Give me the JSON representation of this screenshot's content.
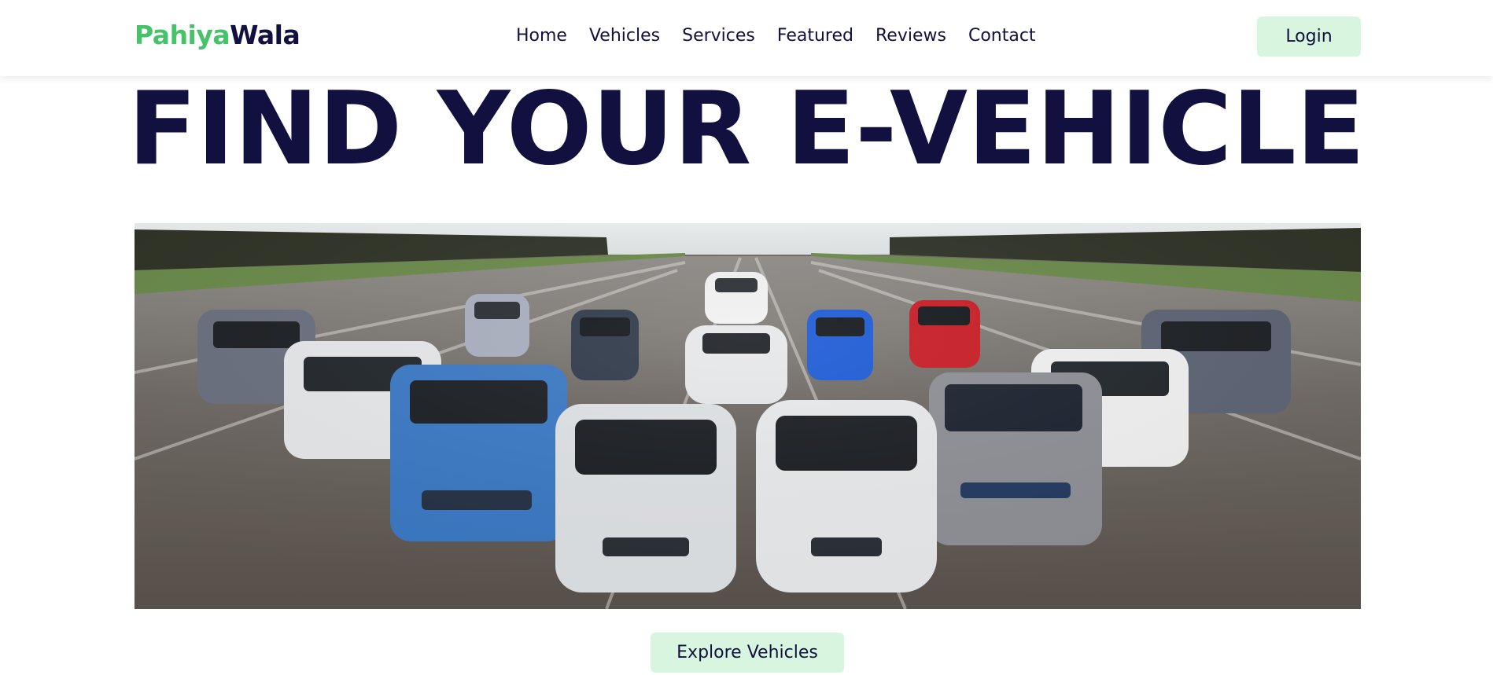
{
  "header": {
    "logo_part1": "Pahiya",
    "logo_part2": "Wala",
    "nav": [
      "Home",
      "Vehicles",
      "Services",
      "Featured",
      "Reviews",
      "Contact"
    ],
    "login_label": "Login"
  },
  "hero": {
    "title": "FIND YOUR E-VEHICLE",
    "image_alt": "Group of electric vehicles on a runway",
    "cta_label": "Explore Vehicles"
  },
  "colors": {
    "brand_green": "#47c16a",
    "brand_navy": "#11103f",
    "button_bg": "#d8f6df"
  }
}
